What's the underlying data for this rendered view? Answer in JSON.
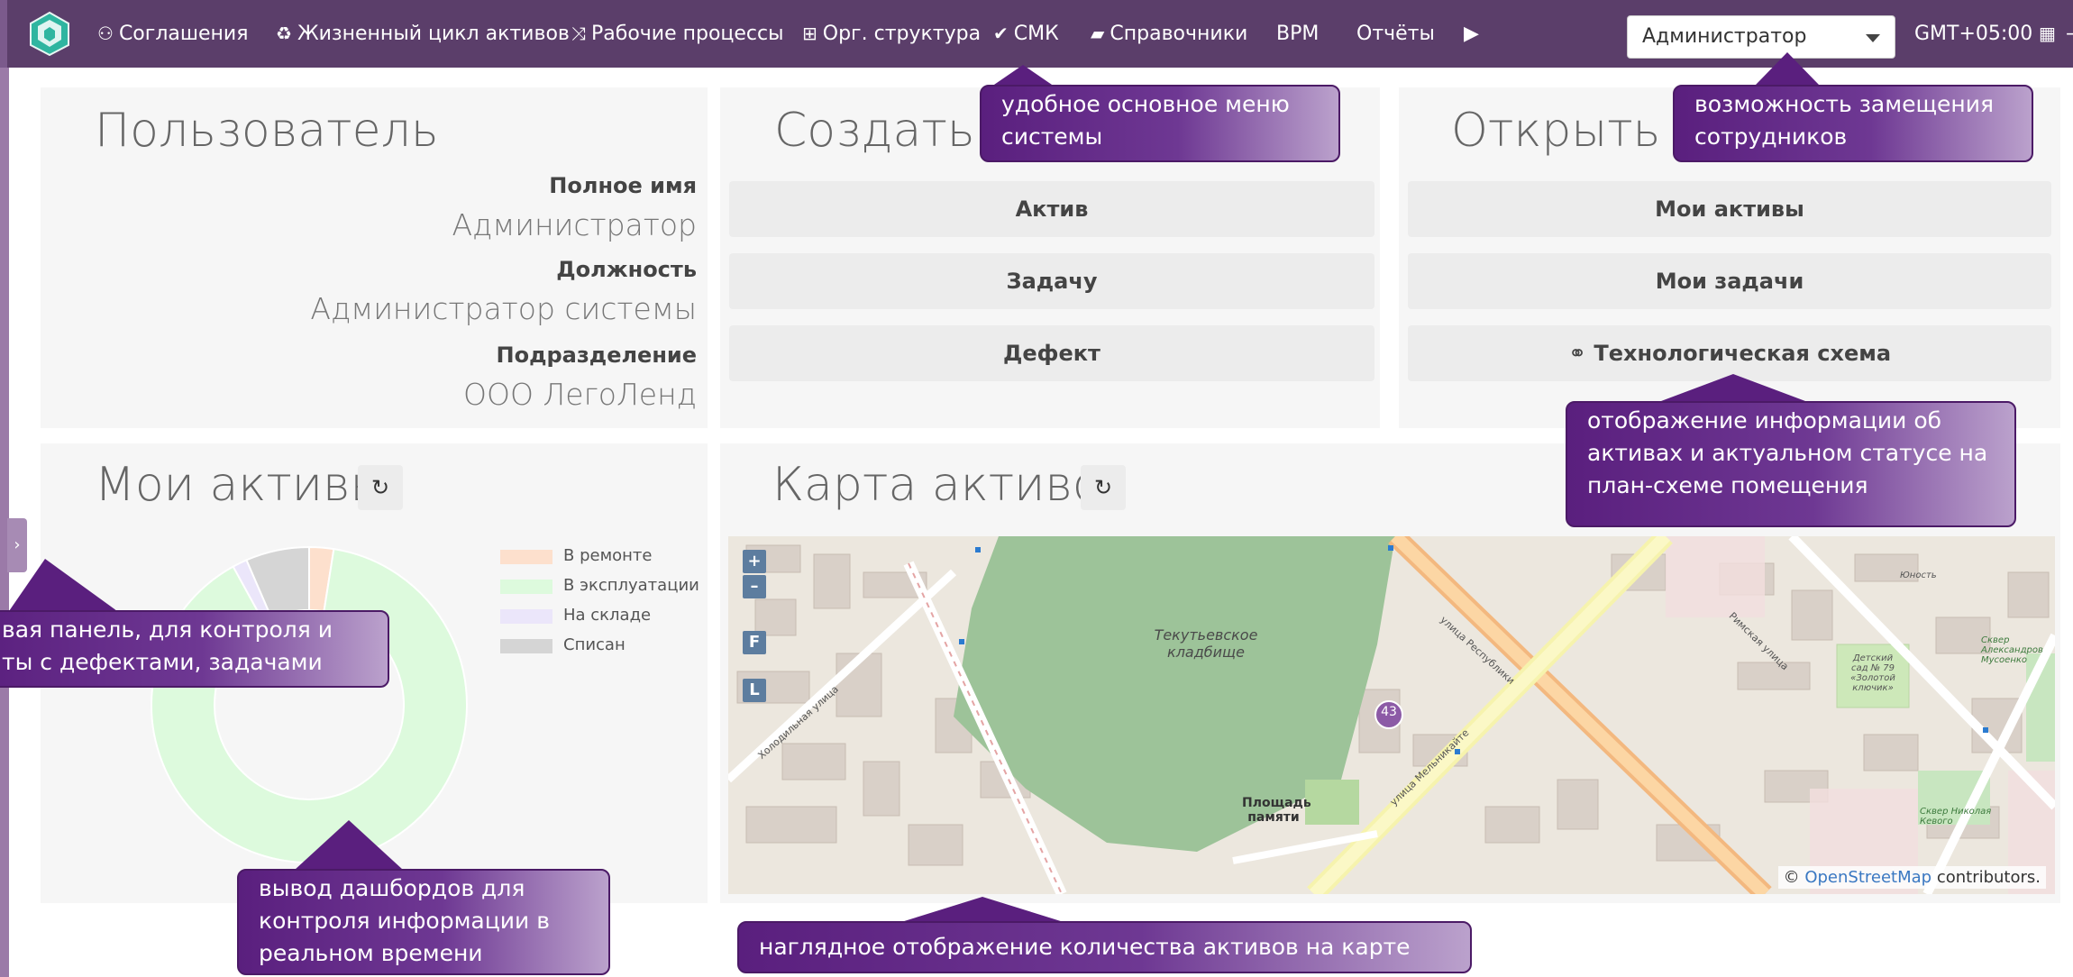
{
  "nav": {
    "items": [
      {
        "label": "Соглашения",
        "icon": "handshake-icon"
      },
      {
        "label": "Жизненный цикл активов",
        "icon": "recycle-icon"
      },
      {
        "label": "Рабочие процессы",
        "icon": "shuffle-icon"
      },
      {
        "label": "Орг. структура",
        "icon": "sitemap-icon"
      },
      {
        "label": "СМК",
        "icon": "check-icon"
      },
      {
        "label": "Справочники",
        "icon": "book-icon"
      },
      {
        "label": "BPM",
        "icon": ""
      },
      {
        "label": "Отчёты",
        "icon": ""
      }
    ],
    "more_icon": "play-icon",
    "role": "Администратор",
    "timezone": "GMT+05:00",
    "colors": {
      "topbar": "#5b3e6a",
      "callout": "#5a1f7e"
    }
  },
  "user": {
    "title": "Пользователь",
    "full_name_label": "Полное имя",
    "full_name": "Администратор",
    "position_label": "Должность",
    "position": "Администратор системы",
    "department_label": "Подразделение",
    "department": "ООО ЛегоЛенд"
  },
  "create": {
    "title": "Создать",
    "buttons": [
      "Актив",
      "Задачу",
      "Дефект"
    ]
  },
  "open": {
    "title": "Открыть",
    "buttons": [
      "Мои активы",
      "Мои задачи",
      "Технологическая схема"
    ],
    "scheme_icon": "link-icon"
  },
  "my_assets": {
    "title": "Мои активы",
    "chart_data": {
      "type": "pie",
      "categories": [
        "В ремонте",
        "В эксплуатации",
        "На складе",
        "Списан"
      ],
      "values": [
        2.5,
        89.5,
        1.5,
        6.5
      ],
      "colors": [
        "#fde0cd",
        "#ddfadd",
        "#ebe6fa",
        "#d5d5d5"
      ],
      "legend": "right",
      "donut": true
    }
  },
  "asset_map": {
    "title": "Карта активов",
    "zoom_in": "+",
    "zoom_out": "–",
    "btn_f": "F",
    "btn_l": "L",
    "labels": {
      "cemetery": "Текутьевское кладбище",
      "square": "Площадь памяти",
      "cluster_count": "43",
      "street_respublika": "улица Республики",
      "street_melnikayte": "улица Мельникайте",
      "street_kholodilnaya": "Холодильная улица",
      "street_rimskaya": "Римская улица",
      "square_aleksandrov": "Сквер Александров Мусоенко",
      "square_nikolaev": "Сквер Николая Кевого",
      "kindergarten": "Детский сад № 79 «Золотой ключик»",
      "park_small": "Юность"
    },
    "attribution_prefix": "©",
    "attribution_link": "OpenStreetMap",
    "attribution_suffix": "contributors."
  },
  "callouts": {
    "menu": "удобное основное меню системы",
    "substitute": "возможность замещения сотрудников",
    "scheme": "отображение информации об активах и актуальном статусе на план-схеме помещения",
    "sidepanel": "вая панель, для контроля и ты с дефектами, задачами",
    "dashboards": "вывод дашбордов для контроля информации в реальном времени",
    "map": "наглядное отображение количества активов на карте"
  }
}
